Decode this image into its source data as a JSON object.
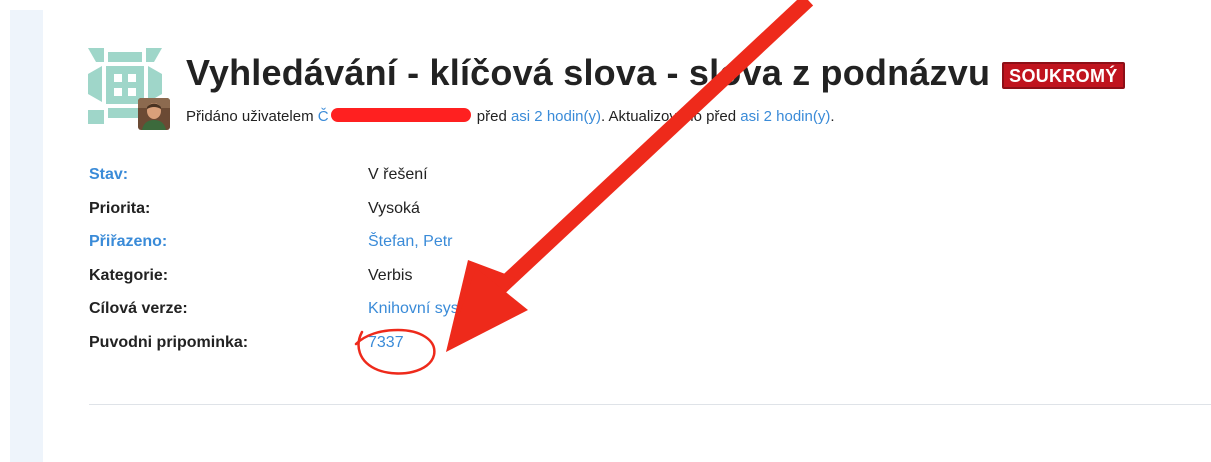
{
  "issue": {
    "title": "Vyhledávání - klíčová slova - slova z podnázvu",
    "badge": "SOUKROMÝ",
    "meta": {
      "added_by_prefix": "Přidáno uživatelem",
      "author_visible_char": "Č",
      "before_label": "před",
      "created_ago": "asi 2 hodin(y)",
      "updated_prefix": "Aktualizováno před",
      "updated_ago": "asi 2 hodin(y)",
      "suffix": "."
    }
  },
  "attributes": [
    {
      "label": "Stav:",
      "value": "V řešení"
    },
    {
      "label": "Priorita:",
      "value": "Vysoká"
    },
    {
      "label": "Přiřazeno:",
      "value": "Štefan, Petr"
    },
    {
      "label": "Kategorie:",
      "value": "Verbis"
    },
    {
      "label": "Cílová verze:",
      "value": "Knihovní systém 2.0"
    },
    {
      "label": "Puvodni pripominka:",
      "value": "7337"
    }
  ],
  "colors": {
    "link": "#3a8bd8",
    "badge": "#c0141e",
    "annotation": "#ee2a1b",
    "sidebar": "#eef4fb"
  },
  "annotations": {
    "arrow": "red-arrow-icon",
    "circle": "red-circle-highlight",
    "redaction": "red-redaction-scribble"
  }
}
